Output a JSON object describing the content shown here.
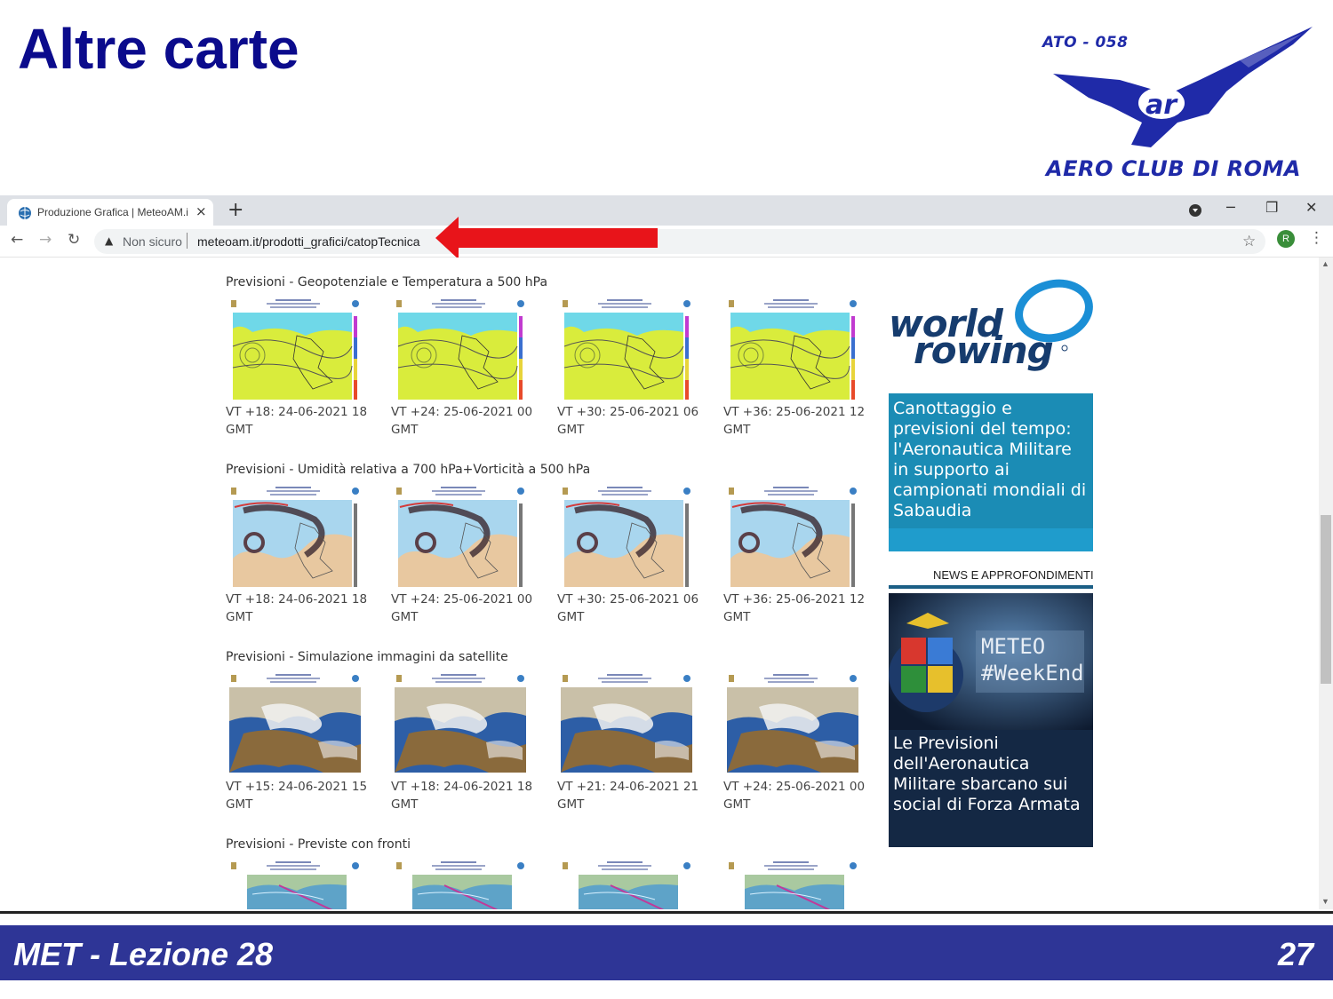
{
  "slide": {
    "title": "Altre carte",
    "logo_top": "ATO - 058",
    "logo_bottom": "AERO CLUB DI ROMA",
    "footer_left": "MET - Lezione 28",
    "footer_right": "27",
    "colors": {
      "title": "#0b0b8c",
      "footer_bg": "#2e3596",
      "logo": "#1f2aa8"
    }
  },
  "browser": {
    "tab_title": "Produzione Grafica | MeteoAM.it",
    "tab_close": "×",
    "new_tab": "+",
    "win_minimize": "─",
    "win_restore": "❐",
    "win_close": "✕",
    "back": "←",
    "forward": "→",
    "reload": "↻",
    "warning_icon": "▲",
    "not_secure": "Non sicuro",
    "url": "meteoam.it/prodotti_grafici/catopTecnica",
    "star": "☆",
    "avatar_letter": "R",
    "menu": "⋮",
    "arrow_color": "#e8141a"
  },
  "sections": [
    {
      "title": "Previsioni - Geopotenziale e Temperatura a 500 hPa",
      "map_type": "geopotential",
      "captions": [
        [
          "VT +18: 24-06-2021 18",
          "GMT"
        ],
        [
          "VT +24: 25-06-2021 00",
          "GMT"
        ],
        [
          "VT +30: 25-06-2021 06",
          "GMT"
        ],
        [
          "VT +36: 25-06-2021 12",
          "GMT"
        ]
      ]
    },
    {
      "title": "Previsioni - Umidità relativa a 700 hPa+Vorticità a 500 hPa",
      "map_type": "humidity",
      "captions": [
        [
          "VT +18: 24-06-2021 18",
          "GMT"
        ],
        [
          "VT +24: 25-06-2021 00",
          "GMT"
        ],
        [
          "VT +30: 25-06-2021 06",
          "GMT"
        ],
        [
          "VT +36: 25-06-2021 12",
          "GMT"
        ]
      ]
    },
    {
      "title": "Previsioni - Simulazione immagini da satellite",
      "map_type": "satellite",
      "captions": [
        [
          "VT +15: 24-06-2021 15",
          "GMT"
        ],
        [
          "VT +18: 24-06-2021 18",
          "GMT"
        ],
        [
          "VT +21: 24-06-2021 21",
          "GMT"
        ],
        [
          "VT +24: 25-06-2021 00",
          "GMT"
        ]
      ]
    },
    {
      "title": "Previsioni - Previste con fronti",
      "map_type": "fronts",
      "captions": []
    }
  ],
  "sidebar": {
    "ad1_logo_line1": "world",
    "ad1_logo_line2": "rowing",
    "ad1_text": "Canottaggio e previsioni del tempo: l'Aeronautica Militare in supporto ai campionati mondiali di Sabaudia",
    "news_heading": "NEWS E APPROFONDIMENTI",
    "ad2_meteo": "METEO",
    "ad2_weekend": "#WeekEnd",
    "ad2_text": "Le Previsioni dell'Aeronautica Militare sbarcano sui social di Forza Armata"
  }
}
